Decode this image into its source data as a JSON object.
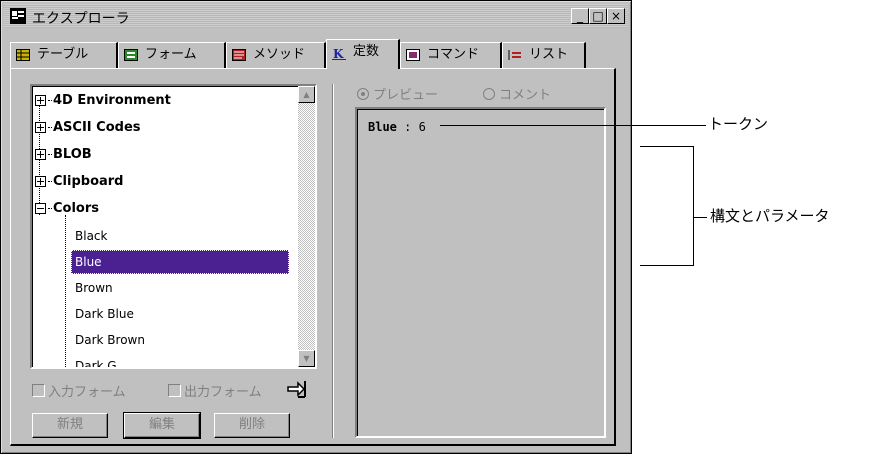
{
  "window": {
    "title": "エクスプローラ",
    "controls": [
      "_",
      "□",
      "×"
    ]
  },
  "tabs": [
    {
      "label": "テーブル",
      "icon": "table-icon"
    },
    {
      "label": "フォーム",
      "icon": "form-icon"
    },
    {
      "label": "メソッド",
      "icon": "method-icon"
    },
    {
      "label": "定数",
      "icon": "constants-icon",
      "active": true
    },
    {
      "label": "コマンド",
      "icon": "command-icon"
    },
    {
      "label": "リスト",
      "icon": "list-icon"
    }
  ],
  "tree": {
    "groups": [
      {
        "label": "4D Environment",
        "expanded": false
      },
      {
        "label": "ASCII Codes",
        "expanded": false
      },
      {
        "label": "BLOB",
        "expanded": false
      },
      {
        "label": "Clipboard",
        "expanded": false
      },
      {
        "label": "Colors",
        "expanded": true
      }
    ],
    "items": [
      "Black",
      "Blue",
      "Brown",
      "Dark Blue",
      "Dark Brown",
      "Dark G..."
    ],
    "selected": "Blue"
  },
  "checkboxes": {
    "input_form": "入力フォーム",
    "output_form": "出力フォーム"
  },
  "buttons": {
    "new": "新規",
    "edit": "編集",
    "delete": "削除"
  },
  "radios": {
    "preview": "プレビュー",
    "comment": "コメント",
    "selected": "preview"
  },
  "preview": {
    "constant_name": "Blue",
    "separator": " : ",
    "constant_value": "6"
  },
  "callouts": {
    "token": "トークン",
    "syntax": "構文とパラメータ"
  }
}
